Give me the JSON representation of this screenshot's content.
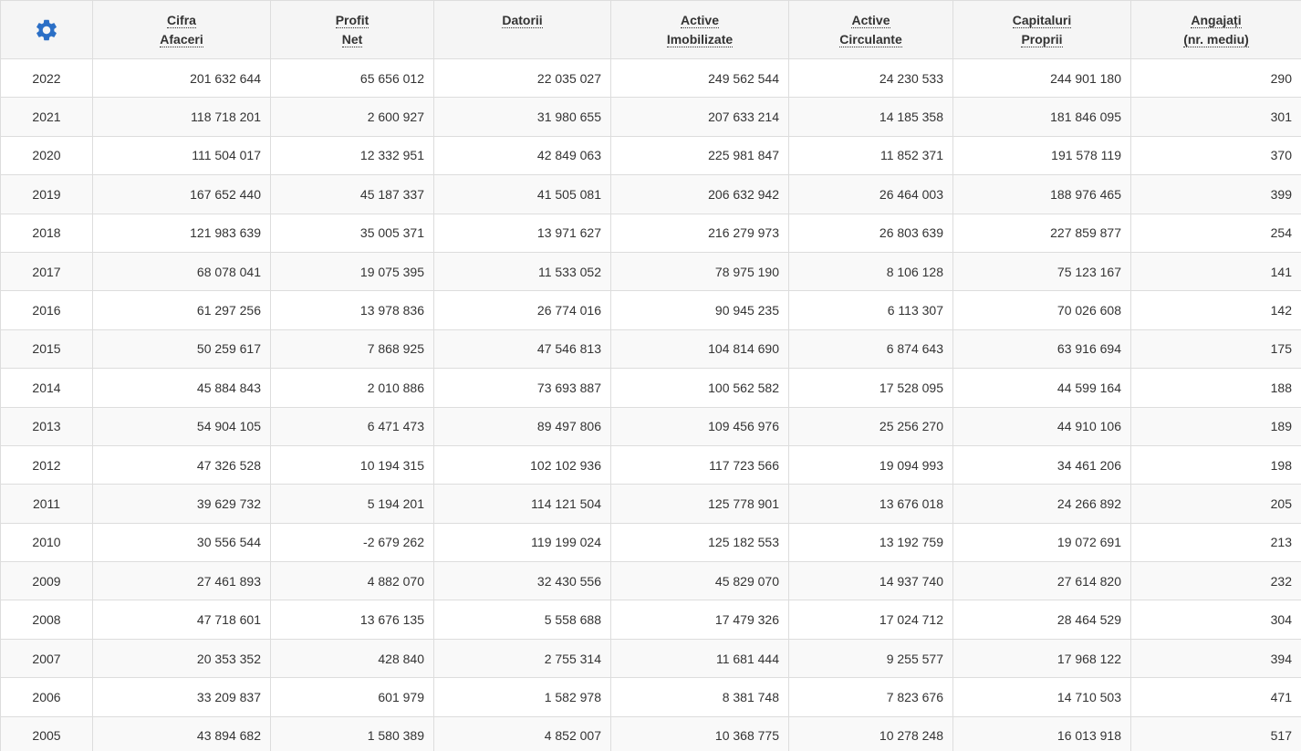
{
  "settings_icon": "gear-icon",
  "accent_color": "#2b6fc6",
  "headers": [
    {
      "line1": "Cifra",
      "line2": "Afaceri"
    },
    {
      "line1": "Profit",
      "line2": "Net"
    },
    {
      "line1": "Datorii",
      "line2": ""
    },
    {
      "line1": "Active",
      "line2": "Imobilizate"
    },
    {
      "line1": "Active",
      "line2": "Circulante"
    },
    {
      "line1": "Capitaluri",
      "line2": "Proprii"
    },
    {
      "line1": "Angajați",
      "line2": "(nr. mediu)"
    }
  ],
  "rows": [
    [
      "2022",
      "201 632 644",
      "65 656 012",
      "22 035 027",
      "249 562 544",
      "24 230 533",
      "244 901 180",
      "290"
    ],
    [
      "2021",
      "118 718 201",
      "2 600 927",
      "31 980 655",
      "207 633 214",
      "14 185 358",
      "181 846 095",
      "301"
    ],
    [
      "2020",
      "111 504 017",
      "12 332 951",
      "42 849 063",
      "225 981 847",
      "11 852 371",
      "191 578 119",
      "370"
    ],
    [
      "2019",
      "167 652 440",
      "45 187 337",
      "41 505 081",
      "206 632 942",
      "26 464 003",
      "188 976 465",
      "399"
    ],
    [
      "2018",
      "121 983 639",
      "35 005 371",
      "13 971 627",
      "216 279 973",
      "26 803 639",
      "227 859 877",
      "254"
    ],
    [
      "2017",
      "68 078 041",
      "19 075 395",
      "11 533 052",
      "78 975 190",
      "8 106 128",
      "75 123 167",
      "141"
    ],
    [
      "2016",
      "61 297 256",
      "13 978 836",
      "26 774 016",
      "90 945 235",
      "6 113 307",
      "70 026 608",
      "142"
    ],
    [
      "2015",
      "50 259 617",
      "7 868 925",
      "47 546 813",
      "104 814 690",
      "6 874 643",
      "63 916 694",
      "175"
    ],
    [
      "2014",
      "45 884 843",
      "2 010 886",
      "73 693 887",
      "100 562 582",
      "17 528 095",
      "44 599 164",
      "188"
    ],
    [
      "2013",
      "54 904 105",
      "6 471 473",
      "89 497 806",
      "109 456 976",
      "25 256 270",
      "44 910 106",
      "189"
    ],
    [
      "2012",
      "47 326 528",
      "10 194 315",
      "102 102 936",
      "117 723 566",
      "19 094 993",
      "34 461 206",
      "198"
    ],
    [
      "2011",
      "39 629 732",
      "5 194 201",
      "114 121 504",
      "125 778 901",
      "13 676 018",
      "24 266 892",
      "205"
    ],
    [
      "2010",
      "30 556 544",
      "-2 679 262",
      "119 199 024",
      "125 182 553",
      "13 192 759",
      "19 072 691",
      "213"
    ],
    [
      "2009",
      "27 461 893",
      "4 882 070",
      "32 430 556",
      "45 829 070",
      "14 937 740",
      "27 614 820",
      "232"
    ],
    [
      "2008",
      "47 718 601",
      "13 676 135",
      "5 558 688",
      "17 479 326",
      "17 024 712",
      "28 464 529",
      "304"
    ],
    [
      "2007",
      "20 353 352",
      "428 840",
      "2 755 314",
      "11 681 444",
      "9 255 577",
      "17 968 122",
      "394"
    ],
    [
      "2006",
      "33 209 837",
      "601 979",
      "1 582 978",
      "8 381 748",
      "7 823 676",
      "14 710 503",
      "471"
    ],
    [
      "2005",
      "43 894 682",
      "1 580 389",
      "4 852 007",
      "10 368 775",
      "10 278 248",
      "16 013 918",
      "517"
    ]
  ]
}
